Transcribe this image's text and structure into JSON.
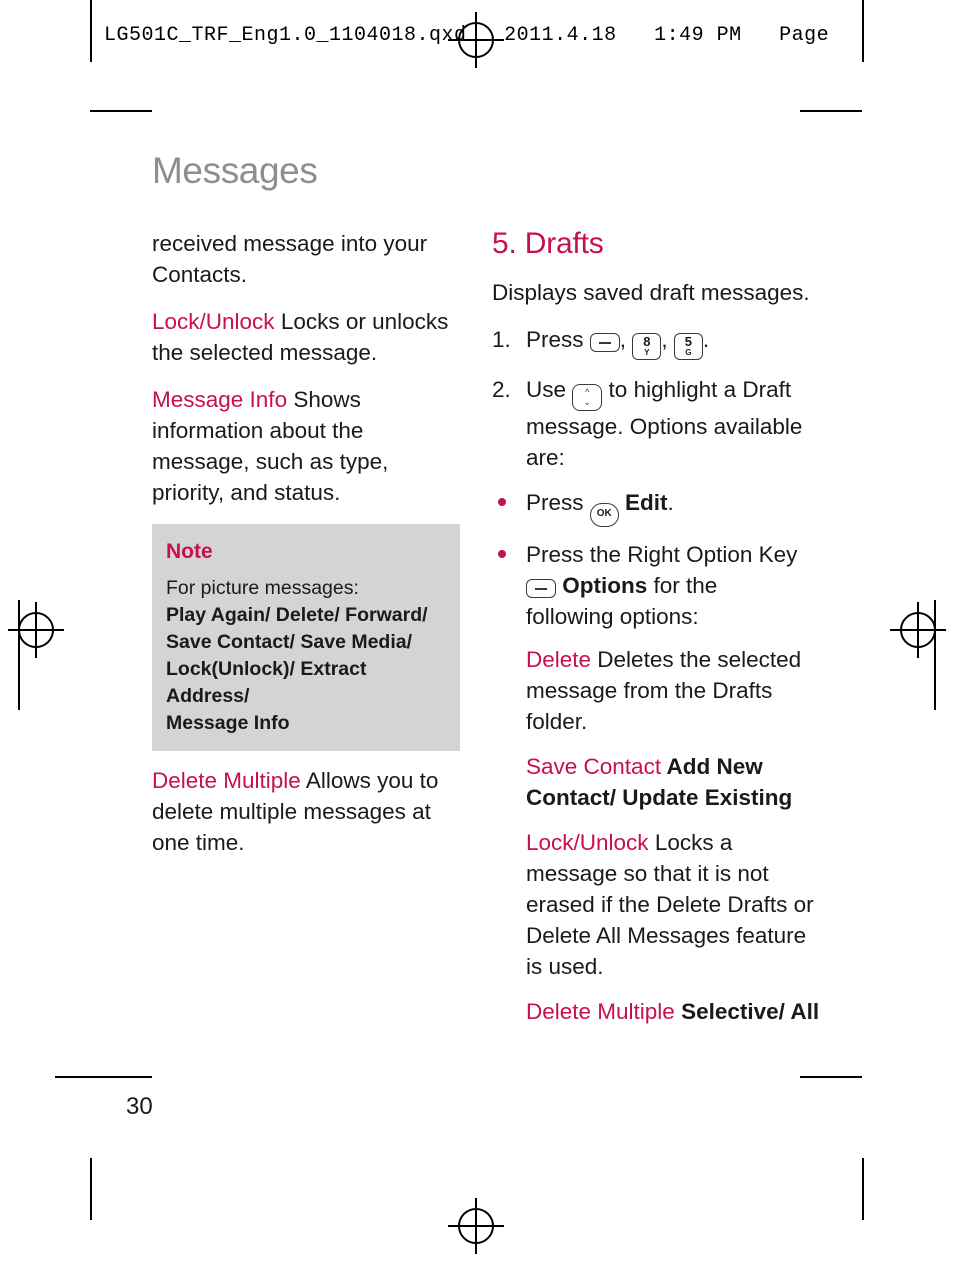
{
  "print_header": "LG501C_TRF_Eng1.0_1104018.qxd   2011.4.18   1:49 PM   Page",
  "chapter_title": "Messages",
  "page_number": "30",
  "left_column": {
    "para1": "received message into your Contacts.",
    "para2_keyword": "Lock/Unlock",
    "para2_text": " Locks or unlocks the selected message.",
    "para3_keyword": "Message Info",
    "para3_text": " Shows information about the message, such as type, priority, and status.",
    "note": {
      "title": "Note",
      "intro": "For picture messages:",
      "lines": [
        "Play Again/ Delete/ Forward/",
        "Save Contact/ Save Media/",
        "Lock(Unlock)/ Extract Address/",
        "Message Info"
      ]
    },
    "para4_keyword": "Delete Multiple",
    "para4_text": " Allows you to delete multiple messages at one time."
  },
  "right_column": {
    "section_heading": "5. Drafts",
    "intro": "Displays saved draft messages.",
    "step1": {
      "number": "1.",
      "text_before": "Press",
      "key1": "soft-key",
      "sep1": ",",
      "key2_big": "8",
      "key2_small": "Y",
      "sep2": ",",
      "key3_big": "5",
      "key3_small": "G",
      "text_after": "."
    },
    "step2": {
      "number": "2.",
      "text_before": "Use",
      "key_nav": "navigation-key",
      "text_after": "to highlight a Draft message. Options available are:"
    },
    "bullet1": {
      "text_before": "Press",
      "key": "OK",
      "text_bold": "Edit",
      "text_after": "."
    },
    "bullet2": {
      "line1": "Press the Right Option Key",
      "key": "soft-key",
      "bold_label": "Options",
      "line2_rest": " for the",
      "line3": "following options:"
    },
    "options": [
      {
        "keyword": "Delete",
        "keyword_bold": false,
        "text": " Deletes the selected message from the Drafts folder."
      },
      {
        "keyword": "Save Contact",
        "keyword_bold": false,
        "text": " Add New Contact/ Update Existing",
        "text_bold": true
      },
      {
        "keyword": "Lock/Unlock",
        "keyword_bold": false,
        "text": " Locks a message so that it is not erased if the Delete Drafts or Delete All Messages feature is used."
      },
      {
        "keyword": "Delete Multiple",
        "keyword_bold": false,
        "text": "  Selective/ All",
        "text_bold": true
      }
    ]
  }
}
